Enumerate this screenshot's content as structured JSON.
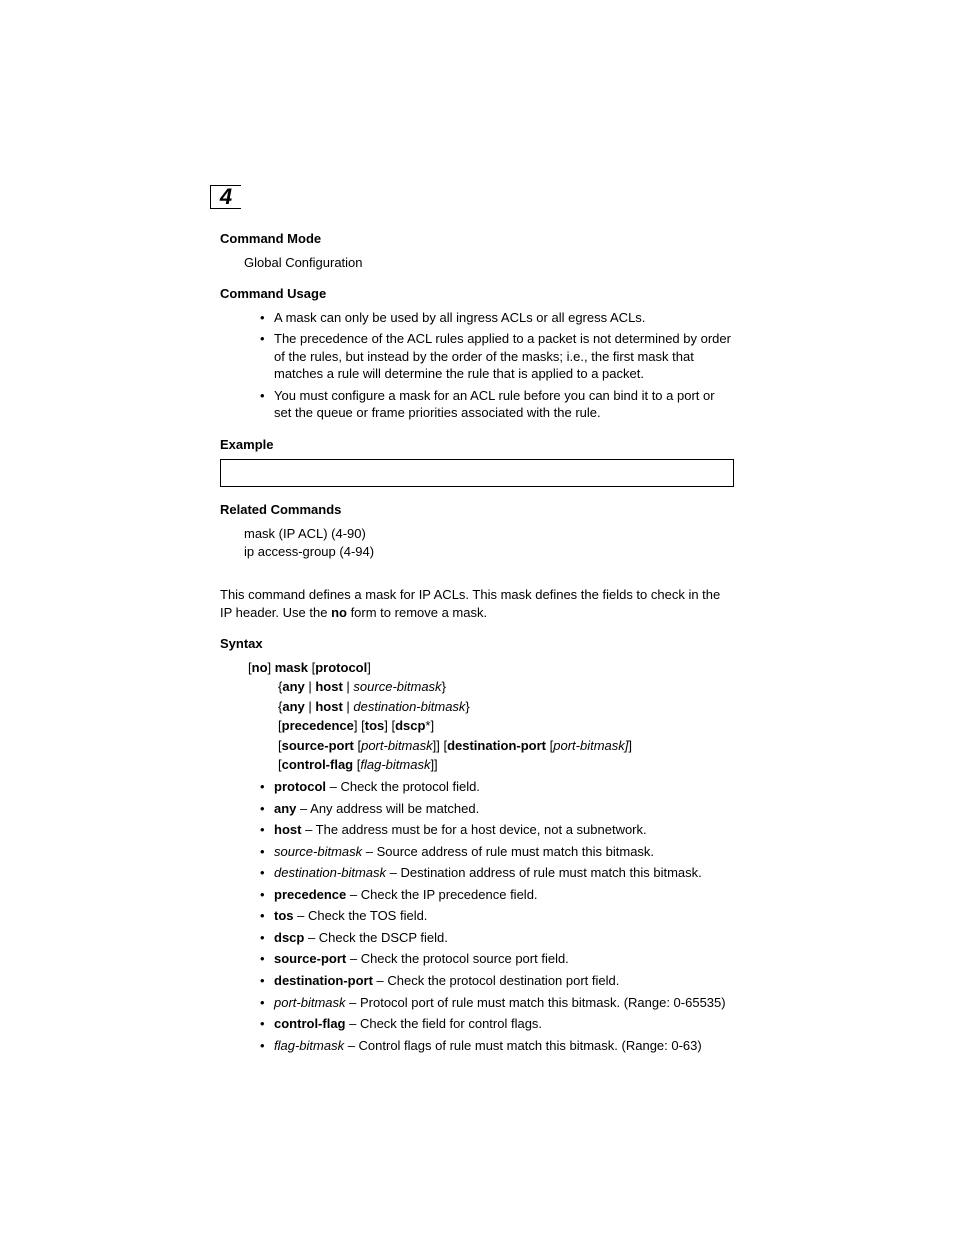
{
  "chapter": "4",
  "sections": {
    "commandMode": {
      "title": "Command Mode",
      "text": "Global Configuration"
    },
    "commandUsage": {
      "title": "Command Usage",
      "items": [
        "A mask can only be used by all ingress ACLs or all egress ACLs.",
        "The precedence of the ACL rules applied to a packet is not determined by order of the rules, but instead by the order of the masks; i.e., the first mask that matches a rule will determine the rule that is applied to a packet.",
        "You must configure a mask for an ACL rule before you can bind it to a port or set the queue or frame priorities associated with the rule."
      ]
    },
    "example": {
      "title": "Example"
    },
    "related": {
      "title": "Related Commands",
      "items": [
        "mask (IP ACL) (4-90)",
        "ip access-group (4-94)"
      ]
    },
    "description": {
      "pre": "This command defines a mask for IP ACLs. This mask defines the fields to check in the IP header. Use the ",
      "bold": "no",
      "post": " form to remove a mask."
    },
    "syntax": {
      "title": "Syntax",
      "kw_no": "no",
      "kw_mask": "mask",
      "kw_protocol": "protocol",
      "kw_any": "any",
      "kw_host": "host",
      "src_bitmask": "source-bitmask",
      "dst_bitmask": "destination-bitmask",
      "kw_precedence": "precedence",
      "kw_tos": "tos",
      "kw_dscp": "dscp",
      "kw_source_port": "source-port",
      "port_bitmask": "port-bitmask",
      "kw_destination_port": "destination-port",
      "port_bitmask2": "port-bitmask",
      "kw_control_flag": "control-flag",
      "flag_bitmask": "flag-bitmask"
    },
    "params": [
      {
        "pre": "",
        "bold": "protocol",
        "italic": "",
        "post": " – Check the protocol field."
      },
      {
        "pre": "",
        "bold": "any",
        "italic": "",
        "post": " – Any address will be matched."
      },
      {
        "pre": "",
        "bold": "host",
        "italic": "",
        "post": " – The address must be for a host device, not a subnetwork."
      },
      {
        "pre": "",
        "bold": "",
        "italic": "source-bitmask",
        "post": " – Source address of rule must match this bitmask."
      },
      {
        "pre": "",
        "bold": "",
        "italic": "destination-bitmask",
        "post": " – Destination address of rule must match this bitmask."
      },
      {
        "pre": "",
        "bold": "precedence",
        "italic": "",
        "post": " – Check the IP precedence field."
      },
      {
        "pre": "",
        "bold": "tos",
        "italic": "",
        "post": " – Check the TOS field."
      },
      {
        "pre": "",
        "bold": "dscp",
        "italic": "",
        "post": " – Check the DSCP field."
      },
      {
        "pre": "",
        "bold": "source-port",
        "italic": "",
        "post": " – Check the protocol source port field."
      },
      {
        "pre": "",
        "bold": "destination-port",
        "italic": "",
        "post": " – Check the protocol destination port field."
      },
      {
        "pre": "",
        "bold": "",
        "italic": "port-bitmask",
        "post": " – Protocol port of rule must match this bitmask. (Range: 0-65535)"
      },
      {
        "pre": "",
        "bold": "control-flag",
        "italic": "",
        "post": " – Check the field for control flags."
      },
      {
        "pre": "",
        "bold": "",
        "italic": "flag-bitmask",
        "post": " – Control flags of rule must match this bitmask. (Range: 0-63)"
      }
    ]
  }
}
